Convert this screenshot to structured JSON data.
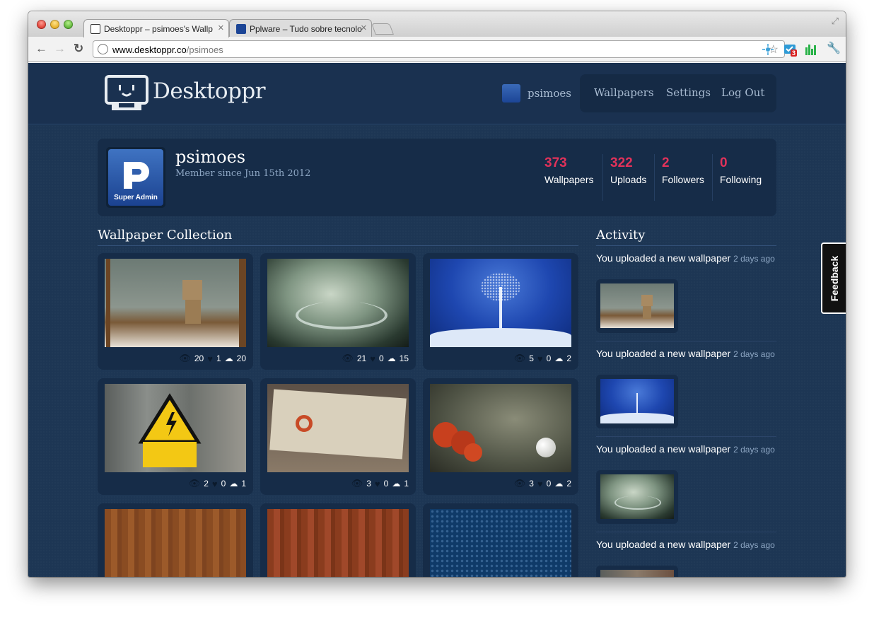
{
  "browser": {
    "tabs": [
      {
        "title": "Desktoppr – psimoes's Wallp",
        "active": true
      },
      {
        "title": "Pplware – Tudo sobre tecnolo",
        "active": false
      }
    ],
    "url_host": "www.desktoppr.co",
    "url_path": "/psimoes",
    "extension_badge": "3"
  },
  "site": {
    "logo_text": "Desktoppr",
    "user": "psimoes",
    "nav": [
      "Wallpapers",
      "Settings",
      "Log Out"
    ]
  },
  "profile": {
    "name": "psimoes",
    "member_since": "Member since Jun 15th 2012",
    "avatar_label": "Super Admin",
    "stats": [
      {
        "value": "373",
        "label": "Wallpapers"
      },
      {
        "value": "322",
        "label": "Uploads"
      },
      {
        "value": "2",
        "label": "Followers"
      },
      {
        "value": "0",
        "label": "Following"
      }
    ]
  },
  "collection": {
    "title": "Wallpaper Collection",
    "items": [
      {
        "views": "20",
        "likes": "1",
        "saves": "20"
      },
      {
        "views": "21",
        "likes": "0",
        "saves": "15"
      },
      {
        "views": "5",
        "likes": "0",
        "saves": "2"
      },
      {
        "views": "2",
        "likes": "0",
        "saves": "1"
      },
      {
        "views": "3",
        "likes": "0",
        "saves": "1"
      },
      {
        "views": "3",
        "likes": "0",
        "saves": "2"
      },
      {},
      {},
      {}
    ]
  },
  "activity": {
    "title": "Activity",
    "items": [
      {
        "text": "You uploaded a new wallpaper",
        "time": "2 days ago"
      },
      {
        "text": "You uploaded a new wallpaper",
        "time": "2 days ago"
      },
      {
        "text": "You uploaded a new wallpaper",
        "time": "2 days ago"
      },
      {
        "text": "You uploaded a new wallpaper",
        "time": "2 days ago"
      }
    ]
  },
  "feedback_label": "Feedback",
  "colors": {
    "accent": "#e1325a",
    "page_bg": "#1d3654",
    "panel_bg": "#162c48"
  }
}
